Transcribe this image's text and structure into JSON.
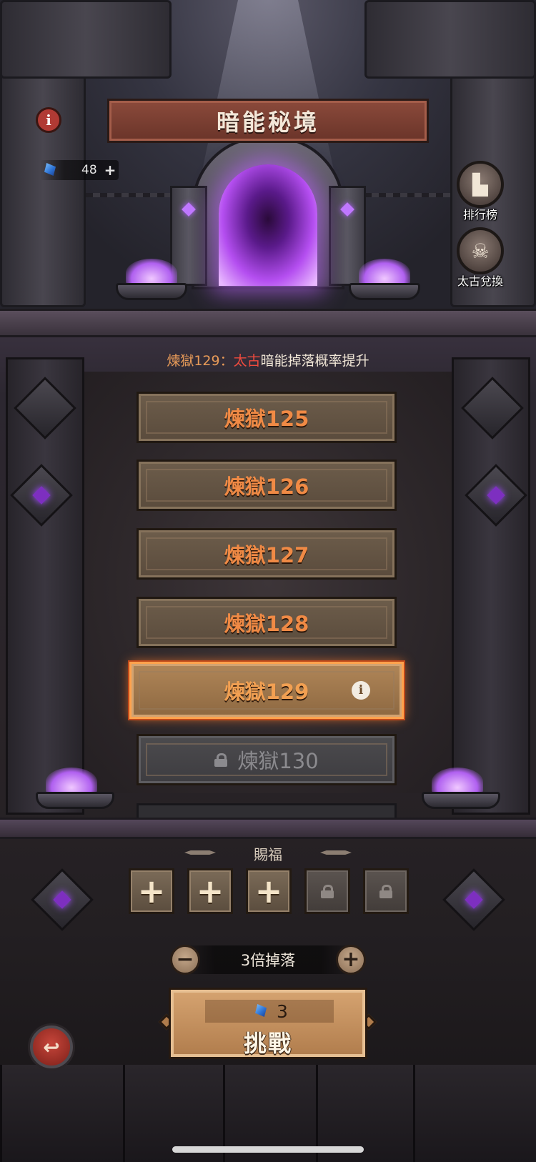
{
  "header": {
    "title": "暗能秘境"
  },
  "currency": {
    "icon": "blue-crystal-icon",
    "value": "48",
    "plus": "+"
  },
  "side_buttons": {
    "leaderboard_label": "排行榜",
    "exchange_label": "太古兌換"
  },
  "notice": {
    "prefix": "煉獄129：",
    "highlight": "太古",
    "suffix": "暗能掉落概率提升"
  },
  "stages": [
    {
      "label": "煉獄125",
      "state": "normal"
    },
    {
      "label": "煉獄126",
      "state": "normal"
    },
    {
      "label": "煉獄127",
      "state": "normal"
    },
    {
      "label": "煉獄128",
      "state": "normal"
    },
    {
      "label": "煉獄129",
      "state": "selected"
    },
    {
      "label": "煉獄130",
      "state": "locked"
    }
  ],
  "blessing": {
    "title": "賜福",
    "slots": [
      {
        "state": "add",
        "symbol": "+"
      },
      {
        "state": "add",
        "symbol": "+"
      },
      {
        "state": "add",
        "symbol": "+"
      },
      {
        "state": "locked"
      },
      {
        "state": "locked"
      }
    ]
  },
  "multiplier": {
    "minus": "−",
    "text": "3倍掉落",
    "plus": "+"
  },
  "challenge": {
    "cost": "3",
    "label": "挑戰"
  },
  "info_symbol": "i",
  "back_symbol": "↩",
  "colors": {
    "accent_orange": "#e79a58",
    "highlight_red": "#ef4a3e",
    "portal_purple": "#b44ef0"
  }
}
